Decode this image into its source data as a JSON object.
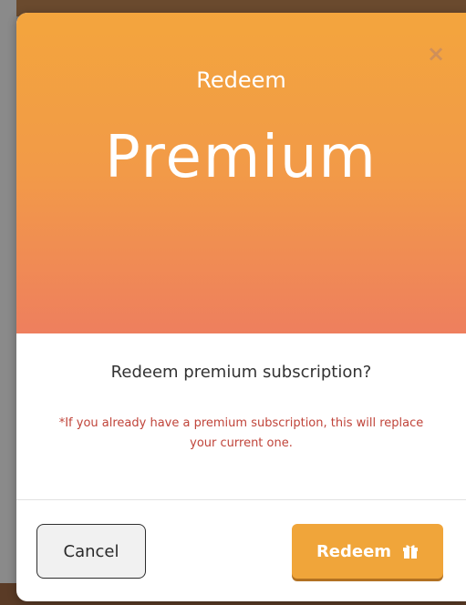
{
  "modal": {
    "close_icon": "close-icon",
    "banner_subtitle": "Redeem",
    "banner_title": "Premium",
    "question": "Redeem premium subscription?",
    "warning": "*If you already have a premium subscription, this will replace your current one.",
    "cancel_label": "Cancel",
    "redeem_label": "Redeem",
    "redeem_icon": "gift-icon"
  },
  "colors": {
    "banner_top": "#f3a53d",
    "banner_bottom": "#ee7f5e",
    "warning": "#c0443a",
    "primary_button": "#f0a53a"
  }
}
